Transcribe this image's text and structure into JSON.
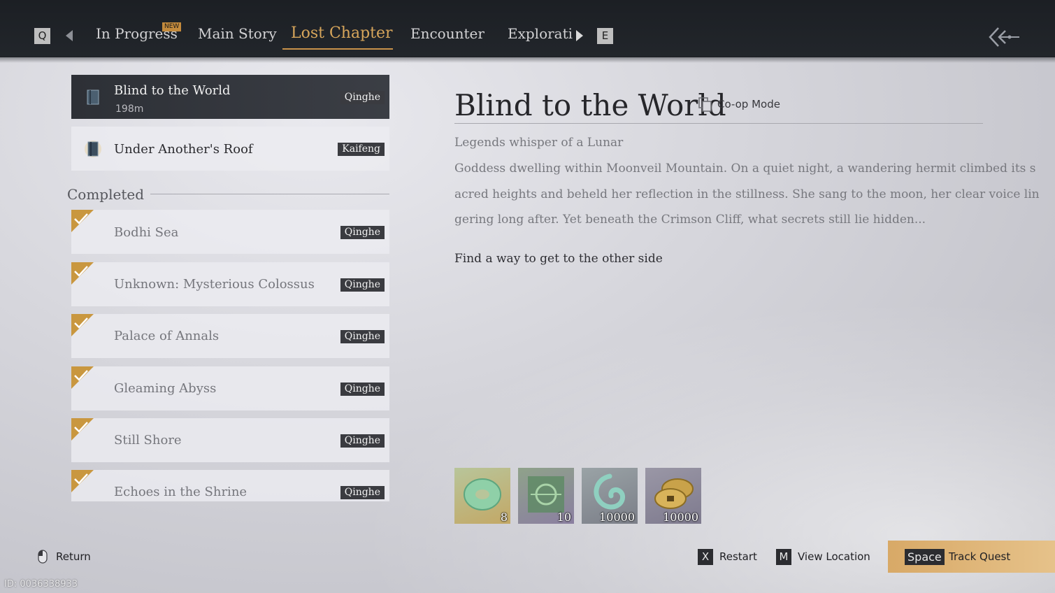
{
  "tabs": {
    "prev_key": "Q",
    "next_key": "E",
    "items": [
      {
        "label": "In Progress",
        "badge": "NEW"
      },
      {
        "label": "Main Story"
      },
      {
        "label": "Lost Chapter",
        "active": true
      },
      {
        "label": "Encounter"
      },
      {
        "label": "Explorati"
      }
    ]
  },
  "active_quests": [
    {
      "title": "Blind to the World",
      "distance": "198m",
      "region": "Qinghe",
      "selected": true
    },
    {
      "title": "Under Another's Roof",
      "region": "Kaifeng"
    }
  ],
  "completed": {
    "label": "Completed",
    "items": [
      {
        "title": "Bodhi Sea",
        "region": "Qinghe"
      },
      {
        "title": "Unknown: Mysterious Colossus",
        "region": "Qinghe"
      },
      {
        "title": "Palace of Annals",
        "region": "Qinghe"
      },
      {
        "title": "Gleaming Abyss",
        "region": "Qinghe"
      },
      {
        "title": "Still Shore",
        "region": "Qinghe"
      },
      {
        "title": "Echoes in the Shrine",
        "region": "Qinghe"
      }
    ]
  },
  "detail": {
    "title": "Blind to the World",
    "mode": "Co-op Mode",
    "description_lines": [
      "Legends whisper of a Lunar",
      "Goddess dwelling within Moonveil Mountain. On a quiet night, a wandering hermit climbed its s",
      "acred heights and beheld her reflection in the stillness. She sang to the moon, her clear voice lin",
      "gering long after. Yet beneath the Crimson Cliff, what secrets still lie hidden..."
    ],
    "objective": "Find a way to get to the other side",
    "rewards": [
      {
        "icon": "jade-ring-icon",
        "qty": "8"
      },
      {
        "icon": "green-rune-icon",
        "qty": "10"
      },
      {
        "icon": "swirl-token-icon",
        "qty": "10000"
      },
      {
        "icon": "coin-stack-icon",
        "qty": "10000"
      }
    ]
  },
  "footer": {
    "return_label": "Return",
    "restart_key": "X",
    "restart_label": "Restart",
    "location_key": "M",
    "location_label": "View Location",
    "track_key": "Space",
    "track_label": "Track Quest",
    "player_id": "ID: 0036338933"
  },
  "colors": {
    "accent_gold": "#d7a65b",
    "top_bar": "#1c1f24",
    "region_tag": "#3a3b40",
    "track_button": "#d8a967"
  }
}
